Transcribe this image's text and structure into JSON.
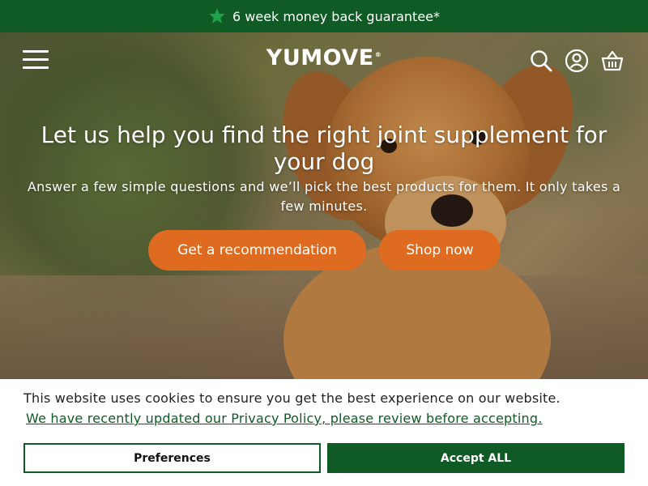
{
  "promo": {
    "icon": "star-icon",
    "text": "6 week money back guarantee*",
    "background": "#0f5a25",
    "star_color": "#1fa34a"
  },
  "header": {
    "logo": "YUMOVE",
    "logo_mark": "®",
    "icons": [
      "hamburger-menu-icon",
      "search-icon",
      "account-icon",
      "basket-icon"
    ]
  },
  "hero": {
    "title": "Let us help you find the right joint supplement for your dog",
    "subtitle": "Answer a few simple questions and we’ll pick the best products for them. It only takes a few minutes.",
    "primary_cta": "Get a recommendation",
    "secondary_cta": "Shop now",
    "cta_color": "#de6b1f"
  },
  "cookie": {
    "text": "This website uses cookies to ensure you get the best experience on our website.",
    "link": "We have recently updated our Privacy Policy, please review before accepting.",
    "preferences_label": "Preferences",
    "accept_label": "Accept ALL",
    "accent": "#0f5a25"
  }
}
